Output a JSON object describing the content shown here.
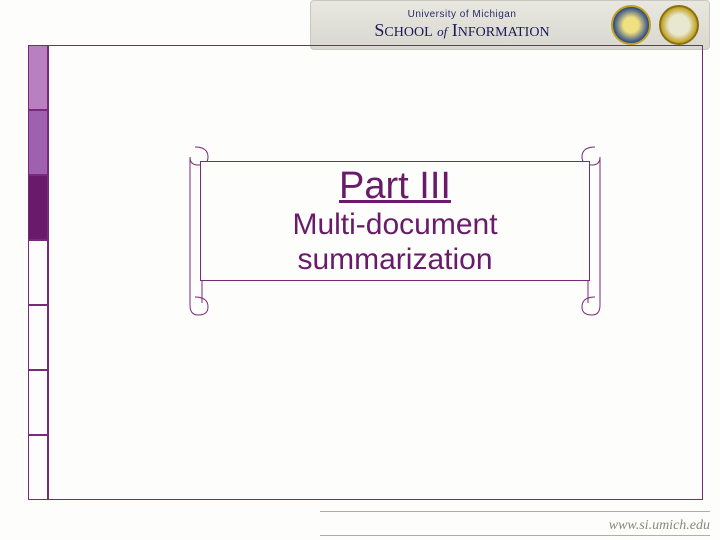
{
  "header": {
    "university": "University of Michigan",
    "school_prefix": "S",
    "school_word1": "CHOOL",
    "school_of": "of",
    "school_word2_prefix": "I",
    "school_word2": "NFORMATION"
  },
  "content": {
    "title": "Part III",
    "subtitle_line1": "Multi-document",
    "subtitle_line2": "summarization"
  },
  "footer": {
    "url": "www.si.umich.edu"
  },
  "colors": {
    "purple_dark": "#6a1a6a",
    "purple_mid": "#a060b0",
    "purple_light": "#b880c0"
  }
}
